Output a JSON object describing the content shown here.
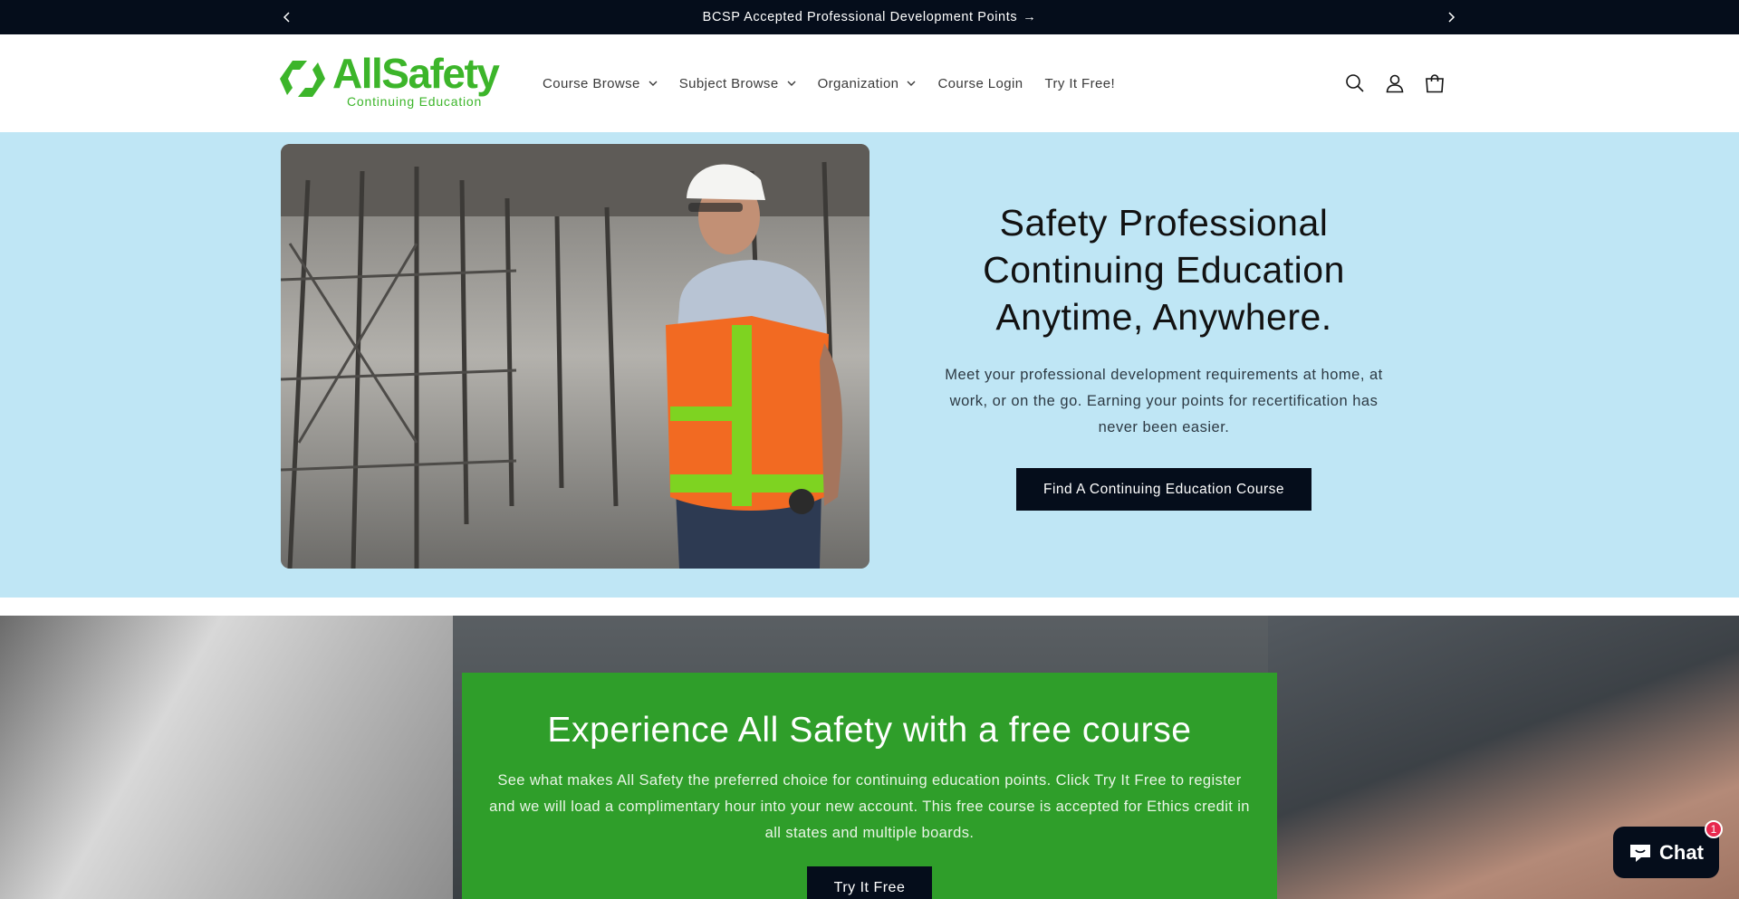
{
  "announcement": {
    "text": "BCSP Accepted Professional Development Points",
    "arrow": "→",
    "prev_icon": "chevron-left-icon",
    "next_icon": "chevron-right-icon"
  },
  "header": {
    "logo": {
      "wordmark": "AllSafety",
      "tagline": "Continuing Education",
      "color": "#3cb52a"
    },
    "nav": [
      {
        "label": "Course Browse",
        "has_dropdown": true
      },
      {
        "label": "Subject Browse",
        "has_dropdown": true
      },
      {
        "label": "Organization",
        "has_dropdown": true
      },
      {
        "label": "Course Login",
        "has_dropdown": false
      },
      {
        "label": "Try It Free!",
        "has_dropdown": false
      }
    ],
    "icons": [
      "search-icon",
      "account-icon",
      "cart-icon"
    ]
  },
  "hero": {
    "title_lines": [
      "Safety Professional",
      "Continuing Education",
      "Anytime, Anywhere."
    ],
    "description": "Meet your professional development requirements at home, at work, or on the go. Earning your points for recertification has never been easier.",
    "button_label": "Find A Continuing Education Course",
    "background": "#bfe6f5"
  },
  "free_course": {
    "title": "Experience All Safety with a free course",
    "description": "See what makes All Safety the preferred choice for continuing education points. Click Try It Free to register and we will load a complimentary hour into your new account. This free course is accepted for Ethics credit in all states and multiple boards.",
    "button_label": "Try It Free",
    "background": "#2f9e2a"
  },
  "chat": {
    "label": "Chat",
    "badge_count": "1"
  }
}
